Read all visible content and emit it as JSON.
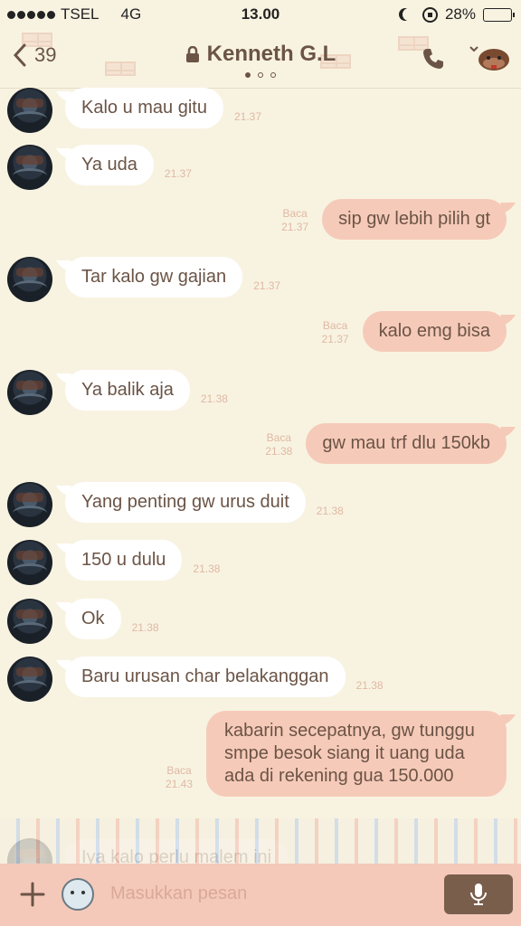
{
  "status_bar": {
    "carrier": "TSEL",
    "network": "4G",
    "time": "13.00",
    "battery": "28%",
    "battery_level": 0.28
  },
  "header": {
    "back_count": "39",
    "contact_name": "Kenneth G.L",
    "page_dots": 3,
    "active_dot": 0
  },
  "messages": [
    {
      "side": "in",
      "text": "Kalo u mau gitu",
      "time": "21.37"
    },
    {
      "side": "in",
      "text": "Ya uda",
      "time": "21.37"
    },
    {
      "side": "out",
      "text": "sip gw lebih pilih gt",
      "read": "Baca",
      "time": "21.37"
    },
    {
      "side": "in",
      "text": "Tar kalo gw gajian",
      "time": "21.37"
    },
    {
      "side": "out",
      "text": "kalo emg bisa",
      "read": "Baca",
      "time": "21.37"
    },
    {
      "side": "in",
      "text": "Ya balik aja",
      "time": "21.38"
    },
    {
      "side": "out",
      "text": "gw mau trf dlu 150kb",
      "read": "Baca",
      "time": "21.38"
    },
    {
      "side": "in",
      "text": "Yang penting gw urus duit",
      "time": "21.38"
    },
    {
      "side": "in",
      "text": "150 u dulu",
      "time": "21.38"
    },
    {
      "side": "in",
      "text": "Ok",
      "time": "21.38"
    },
    {
      "side": "in",
      "text": "Baru urusan char belakanggan",
      "time": "21.38"
    },
    {
      "side": "out",
      "text": "kabarin secepatnya, gw tunggu smpe besok siang it uang uda ada di rekening gua 150.000",
      "read": "Baca",
      "time": "21.43"
    },
    {
      "side": "in",
      "text": "Iya kalo perlu malem ini",
      "time": ""
    }
  ],
  "input": {
    "placeholder": "Masukkan pesan"
  },
  "colors": {
    "background": "#f8f3e1",
    "incoming_bubble": "#ffffff",
    "outgoing_bubble": "#f6cab9",
    "text": "#6b5446",
    "timestamp": "#e0b8a4",
    "input_bar": "#f4c9ba",
    "mic_button": "#7a5e4c"
  },
  "icons": {
    "back": "chevron-left-icon",
    "lock": "lock-icon",
    "call": "phone-icon",
    "menu": "bear-menu-icon",
    "attach": "plus-icon",
    "sticker": "sticker-mascot-icon",
    "voice": "microphone-icon"
  }
}
